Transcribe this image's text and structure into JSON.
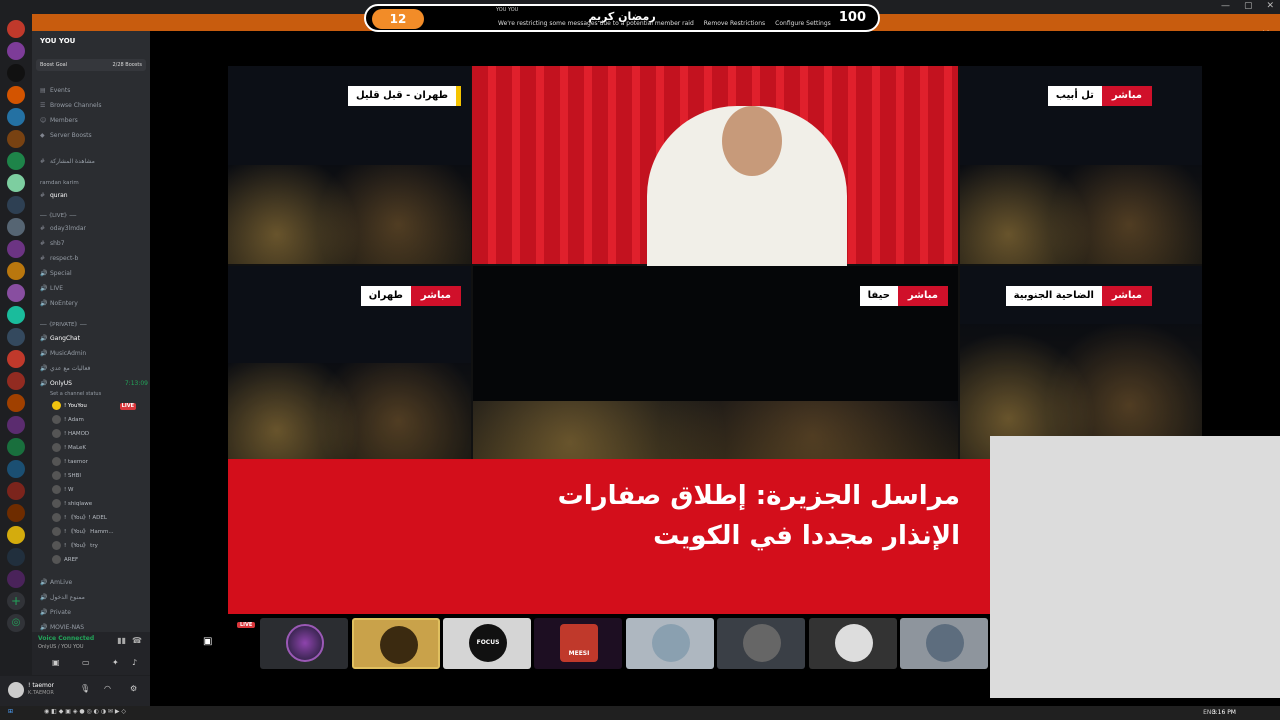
{
  "window": {
    "controls": [
      "—",
      "▢",
      "✕"
    ]
  },
  "raid_banner": {
    "left_count": "12",
    "right_count": "100",
    "title": "رمضان كريم",
    "server_tag": "YOU YOU",
    "message": "We're restricting some messages due to a potential member raid",
    "remove_label": "Remove Restrictions",
    "configure_label": "Configure Settings",
    "close": "✕"
  },
  "server": {
    "name": "YOU YOU",
    "boost_goal": "Boost Goal",
    "boost_count": "2/28 Boosts",
    "menu": [
      "Events",
      "Browse Channels",
      "Members",
      "Server Boosts"
    ]
  },
  "channels": [
    {
      "icon": "#",
      "name": "مشاهدة المشاركة"
    },
    {
      "icon": "",
      "name": "ramdan karim",
      "header": true
    },
    {
      "icon": "#",
      "name": "quran",
      "active": true
    },
    {
      "icon": "",
      "name": "──《LIVE》──",
      "header": true
    },
    {
      "icon": "#",
      "name": "oday3lmdar"
    },
    {
      "icon": "#",
      "name": "shb7"
    },
    {
      "icon": "#",
      "name": "respect-b"
    },
    {
      "icon": "🔊",
      "name": "Special"
    },
    {
      "icon": "🔊",
      "name": "LIVE"
    },
    {
      "icon": "🔊",
      "name": "NoEntery"
    },
    {
      "icon": "",
      "name": "──《PRIVATE》──",
      "header": true
    },
    {
      "icon": "🔊",
      "name": "GangChat",
      "active": true
    },
    {
      "icon": "🔊",
      "name": "MusicAdmin"
    },
    {
      "icon": "🔊",
      "name": "فعاليات مع عدي"
    },
    {
      "icon": "🔊",
      "name": "OnlyUS",
      "active": true
    }
  ],
  "onlyus_time": "7:13:09",
  "onlyus_status": "Set a channel status",
  "voice_users": [
    "! YouYou",
    "! Adam",
    "! HAMOD",
    "! MaLeK",
    "! taemor",
    "! SHBI",
    "! W",
    "! shiqlawe",
    "! 《You》! ADEL",
    "! 《You》 Hamm...",
    "! 《You》 try",
    "AREF"
  ],
  "more_channels": [
    {
      "icon": "🔊",
      "name": "AmLive"
    },
    {
      "icon": "🔊",
      "name": "ممنوع الدخول"
    },
    {
      "icon": "🔊",
      "name": "Private"
    },
    {
      "icon": "🔊",
      "name": "MOVIE-NAS"
    }
  ],
  "live_badge": "LIVE",
  "voice": {
    "status": "Voice Connected",
    "channel": "OnlyUS / YOU YOU"
  },
  "user": {
    "name": "! taemor",
    "tag": "K.TAEMOR"
  },
  "broadcast": {
    "cells": [
      {
        "live": "",
        "city": "طهران - قبل قليل"
      },
      {
        "live": "مباشر",
        "city": "تل أبيب"
      },
      {
        "live": "مباشر",
        "city": "طهران"
      },
      {
        "live": "مباشر",
        "city": "حيفا"
      },
      {
        "live": "مباشر",
        "city": "الضاحية الجنوبية"
      }
    ],
    "headline_1": "مراسل الجزيرة: إطلاق صفارات",
    "headline_2": "الإنذار مجددا في الكويت"
  },
  "participants": [
    "FOCUS",
    "MEESI"
  ],
  "taskbar": {
    "lang": "ENG",
    "time": "3:16 PM"
  }
}
